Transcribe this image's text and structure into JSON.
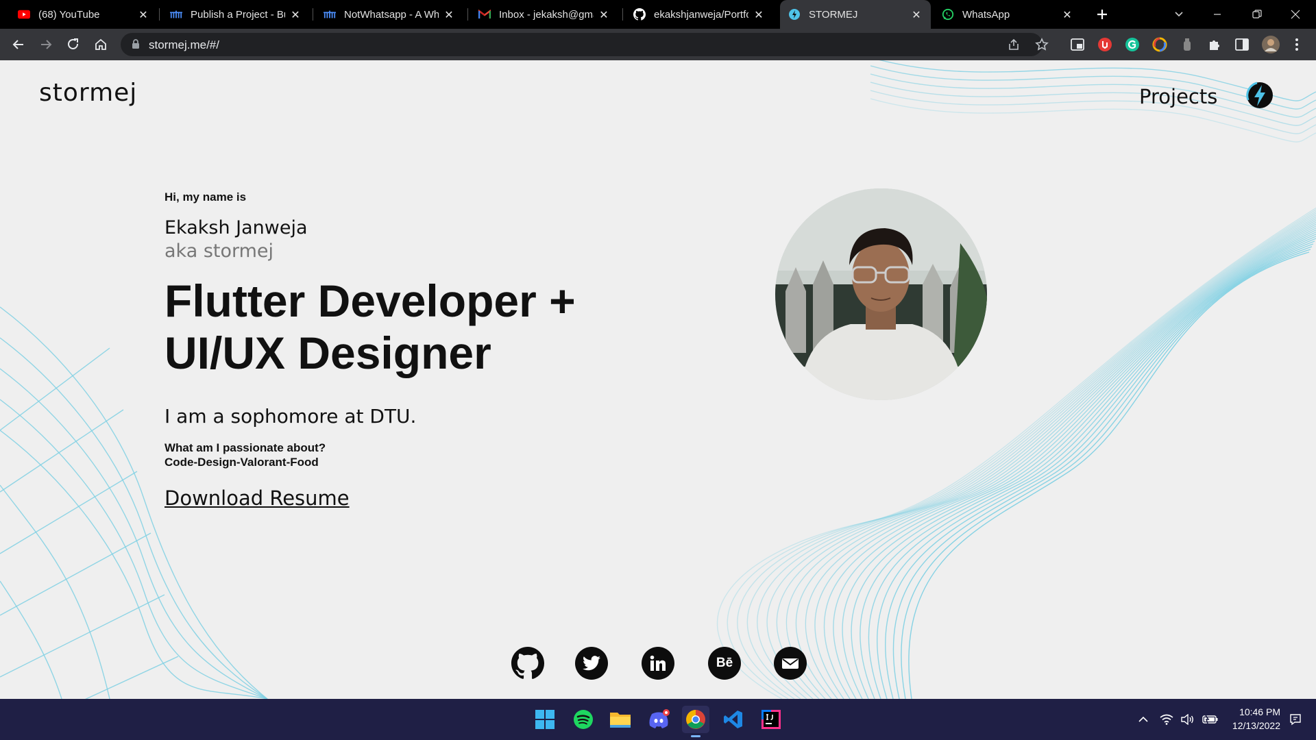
{
  "browser": {
    "tabs": [
      {
        "title": "(68) YouTube",
        "icon": "youtube-icon"
      },
      {
        "title": "Publish a Project - Bu",
        "icon": "devfolio-icon"
      },
      {
        "title": "NotWhatsapp - A Wh",
        "icon": "devfolio-icon"
      },
      {
        "title": "Inbox - jekaksh@gma",
        "icon": "gmail-icon"
      },
      {
        "title": "ekakshjanweja/Portfol",
        "icon": "github-icon"
      },
      {
        "title": "STORMEJ",
        "icon": "site-icon"
      },
      {
        "title": "WhatsApp",
        "icon": "whatsapp-icon"
      }
    ],
    "active_tab_index": 5,
    "url": "stormej.me/#/"
  },
  "site": {
    "logo": "stormej",
    "nav_projects": "Projects",
    "greeting": "Hi, my name is",
    "name": "Ekaksh Janweja",
    "aka": "aka stormej",
    "headline_line1": "Flutter Developer +",
    "headline_line2": "UI/UX Designer",
    "intro": "I am a sophomore at DTU.",
    "passion_question": "What am I passionate about?",
    "passion_answer": "Code-Design-Valorant-Food",
    "resume_link": "Download Resume",
    "socials": [
      "github-icon",
      "twitter-icon",
      "linkedin-icon",
      "behance-icon",
      "mail-icon"
    ],
    "accent_color": "#7fd0e3"
  },
  "taskbar": {
    "apps": [
      "windows-start-icon",
      "spotify-icon",
      "file-explorer-icon",
      "discord-icon",
      "chrome-icon",
      "vscode-icon",
      "intellij-icon"
    ],
    "time": "10:46 PM",
    "date": "12/13/2022"
  }
}
